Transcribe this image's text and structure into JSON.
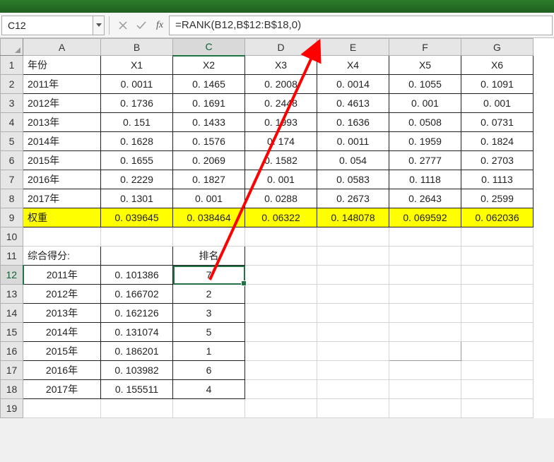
{
  "nameBox": "C12",
  "formulaBar": "=RANK(B12,B$12:B$18,0)",
  "fxLabel": "fx",
  "colHeaders": [
    "A",
    "B",
    "C",
    "D",
    "E",
    "F",
    "G"
  ],
  "rowHeaders": [
    "1",
    "2",
    "3",
    "4",
    "5",
    "6",
    "7",
    "8",
    "9",
    "10",
    "11",
    "12",
    "13",
    "14",
    "15",
    "16",
    "17",
    "18",
    "19"
  ],
  "chart_data": {
    "type": "table",
    "tables": [
      {
        "title": "主数据表",
        "header_row": [
          "年份",
          "X1",
          "X2",
          "X3",
          "X4",
          "X5",
          "X6"
        ],
        "rows": [
          [
            "2011年",
            "0. 0011",
            "0. 1465",
            "0. 2008",
            "0. 0014",
            "0. 1055",
            "0. 1091"
          ],
          [
            "2012年",
            "0. 1736",
            "0. 1691",
            "0. 2448",
            "0. 4613",
            "0. 001",
            "0. 001"
          ],
          [
            "2013年",
            "0. 151",
            "0. 1433",
            "0. 1993",
            "0. 1636",
            "0. 0508",
            "0. 0731"
          ],
          [
            "2014年",
            "0. 1628",
            "0. 1576",
            "0. 174",
            "0. 0011",
            "0. 1959",
            "0. 1824"
          ],
          [
            "2015年",
            "0. 1655",
            "0. 2069",
            "0. 1582",
            "0. 054",
            "0. 2777",
            "0. 2703"
          ],
          [
            "2016年",
            "0. 2229",
            "0. 1827",
            "0. 001",
            "0. 0583",
            "0. 1118",
            "0. 1113"
          ],
          [
            "2017年",
            "0. 1301",
            "0. 001",
            "0. 0288",
            "0. 2673",
            "0. 2643",
            "0. 2599"
          ]
        ],
        "weight_row": [
          "权重",
          "0. 039645",
          "0. 038464",
          "0. 06322",
          "0. 148078",
          "0. 069592",
          "0. 062036"
        ]
      },
      {
        "title": "综合得分与排名",
        "header_row": [
          "综合得分:",
          "",
          "排名"
        ],
        "rows": [
          [
            "2011年",
            "0. 101386",
            "7"
          ],
          [
            "2012年",
            "0. 166702",
            "2"
          ],
          [
            "2013年",
            "0. 162126",
            "3"
          ],
          [
            "2014年",
            "0. 131074",
            "5"
          ],
          [
            "2015年",
            "0. 186201",
            "1"
          ],
          [
            "2016年",
            "0. 103982",
            "6"
          ],
          [
            "2017年",
            "0. 155511",
            "4"
          ]
        ]
      }
    ]
  },
  "rows": {
    "r1": {
      "A": "年份",
      "B": "X1",
      "C": "X2",
      "D": "X3",
      "E": "X4",
      "F": "X5",
      "G": "X6"
    },
    "r2": {
      "A": "2011年",
      "B": "0. 0011",
      "C": "0. 1465",
      "D": "0. 2008",
      "E": "0. 0014",
      "F": "0. 1055",
      "G": "0. 1091"
    },
    "r3": {
      "A": "2012年",
      "B": "0. 1736",
      "C": "0. 1691",
      "D": "0. 2448",
      "E": "0. 4613",
      "F": "0. 001",
      "G": "0. 001"
    },
    "r4": {
      "A": "2013年",
      "B": "0. 151",
      "C": "0. 1433",
      "D": "0. 1993",
      "E": "0. 1636",
      "F": "0. 0508",
      "G": "0. 0731"
    },
    "r5": {
      "A": "2014年",
      "B": "0. 1628",
      "C": "0. 1576",
      "D": "0. 174",
      "E": "0. 0011",
      "F": "0. 1959",
      "G": "0. 1824"
    },
    "r6": {
      "A": "2015年",
      "B": "0. 1655",
      "C": "0. 2069",
      "D": "0. 1582",
      "E": "0. 054",
      "F": "0. 2777",
      "G": "0. 2703"
    },
    "r7": {
      "A": "2016年",
      "B": "0. 2229",
      "C": "0. 1827",
      "D": "0. 001",
      "E": "0. 0583",
      "F": "0. 1118",
      "G": "0. 1113"
    },
    "r8": {
      "A": "2017年",
      "B": "0. 1301",
      "C": "0. 001",
      "D": "0. 0288",
      "E": "0. 2673",
      "F": "0. 2643",
      "G": "0. 2599"
    },
    "r9": {
      "A": "权重",
      "B": "0. 039645",
      "C": "0. 038464",
      "D": "0. 06322",
      "E": "0. 148078",
      "F": "0. 069592",
      "G": "0. 062036"
    },
    "r11": {
      "A": "综合得分:",
      "C": "排名"
    },
    "r12": {
      "A": "2011年",
      "B": "0. 101386",
      "C": "7"
    },
    "r13": {
      "A": "2012年",
      "B": "0. 166702",
      "C": "2"
    },
    "r14": {
      "A": "2013年",
      "B": "0. 162126",
      "C": "3"
    },
    "r15": {
      "A": "2014年",
      "B": "0. 131074",
      "C": "5"
    },
    "r16": {
      "A": "2015年",
      "B": "0. 186201",
      "C": "1"
    },
    "r17": {
      "A": "2016年",
      "B": "0. 103982",
      "C": "6"
    },
    "r18": {
      "A": "2017年",
      "B": "0. 155511",
      "C": "4"
    }
  }
}
